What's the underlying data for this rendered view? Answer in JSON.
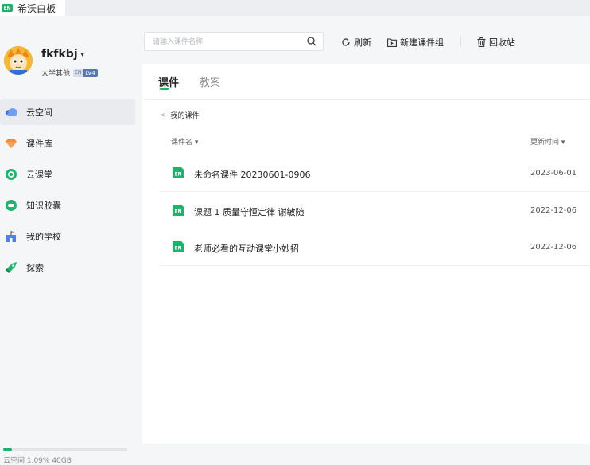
{
  "app": {
    "title": "希沃白板",
    "logo_text": "EN"
  },
  "user": {
    "name": "fkfkbj",
    "org": "大学其他",
    "en_badge": "EN",
    "level": "LV4"
  },
  "nav": {
    "items": [
      {
        "label": "云空间",
        "icon": "cloud-icon",
        "active": true
      },
      {
        "label": "课件库",
        "icon": "gem-icon",
        "active": false
      },
      {
        "label": "云课堂",
        "icon": "cloud-class-icon",
        "active": false
      },
      {
        "label": "知识胶囊",
        "icon": "capsule-icon",
        "active": false
      },
      {
        "label": "我的学校",
        "icon": "school-icon",
        "active": false
      },
      {
        "label": "探索",
        "icon": "rocket-icon",
        "active": false
      }
    ]
  },
  "toolbar": {
    "search_placeholder": "请输入课件名称",
    "refresh_label": "刷新",
    "new_group_label": "新建课件组",
    "recycle_label": "回收站"
  },
  "tabs": {
    "courseware": "课件",
    "lesson_plan": "教案"
  },
  "breadcrumb": {
    "label": "我的课件"
  },
  "table": {
    "col_name": "课件名 ▾",
    "col_updated": "更新时间 ▾",
    "rows": [
      {
        "name": "未命名课件 20230601-0906",
        "date": "2023-06-01"
      },
      {
        "name": "课题 1 质量守恒定律 谢敏随",
        "date": "2022-12-06"
      },
      {
        "name": "老师必看的互动课堂小妙招",
        "date": "2022-12-06"
      }
    ]
  },
  "storage": {
    "text": "云空间  1.09%  40GB",
    "used_fraction": 0.07
  },
  "colors": {
    "accent": "#19b56b",
    "level_badge": "#5777ad"
  }
}
